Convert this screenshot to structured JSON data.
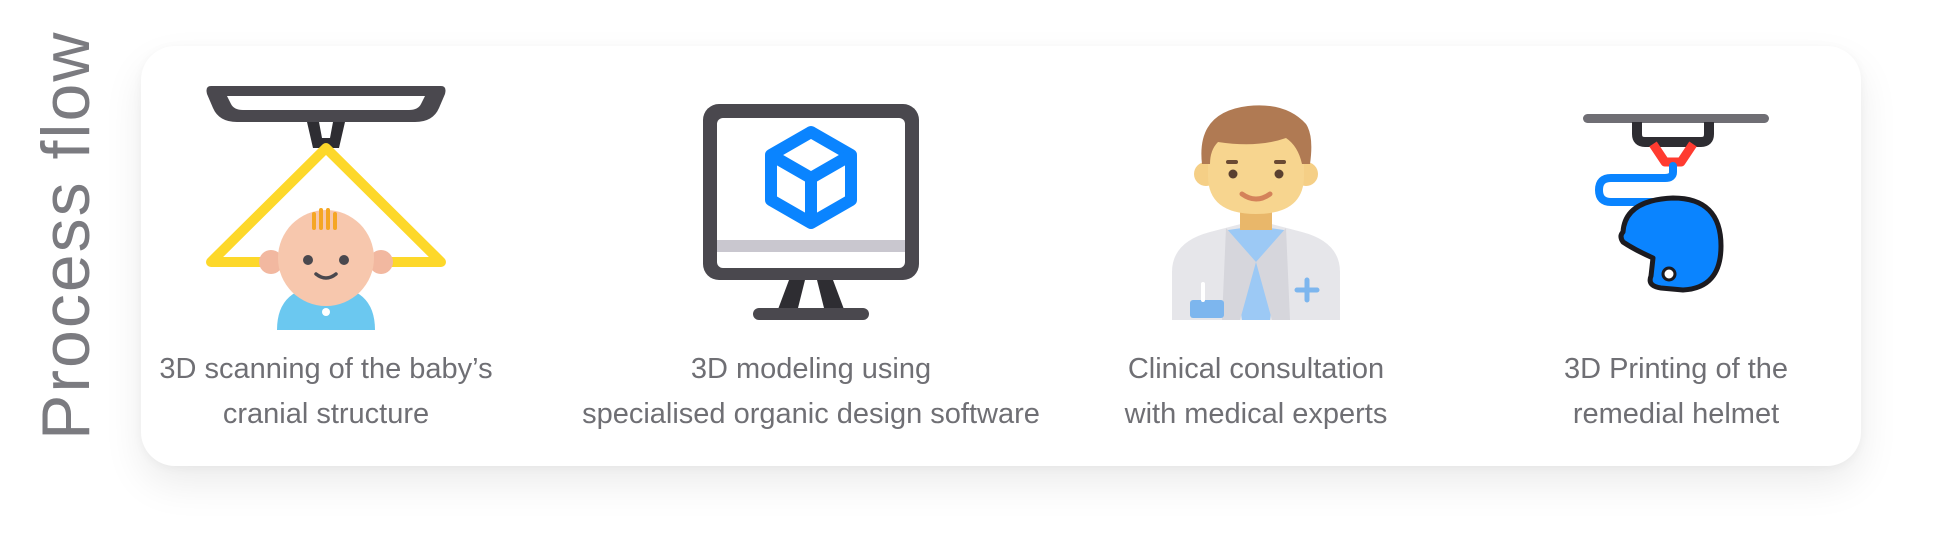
{
  "side_title": "Process flow",
  "steps": [
    {
      "icon": "baby-scan-icon",
      "line1": "3D scanning of the baby’s",
      "line2": "cranial structure"
    },
    {
      "icon": "monitor-cube-icon",
      "line1": "3D modeling using",
      "line2": "specialised organic design software"
    },
    {
      "icon": "doctor-icon",
      "line1": "Clinical consultation",
      "line2": "with medical experts"
    },
    {
      "icon": "3d-printer-helmet-icon",
      "line1": "3D Printing of the",
      "line2": "remedial helmet"
    }
  ],
  "colors": {
    "title": "#7b7b80",
    "caption": "#6f6f74",
    "dark": "#4a484e",
    "yellow": "#fdd82a",
    "blue": "#0a84ff",
    "red": "#ff3b30"
  }
}
